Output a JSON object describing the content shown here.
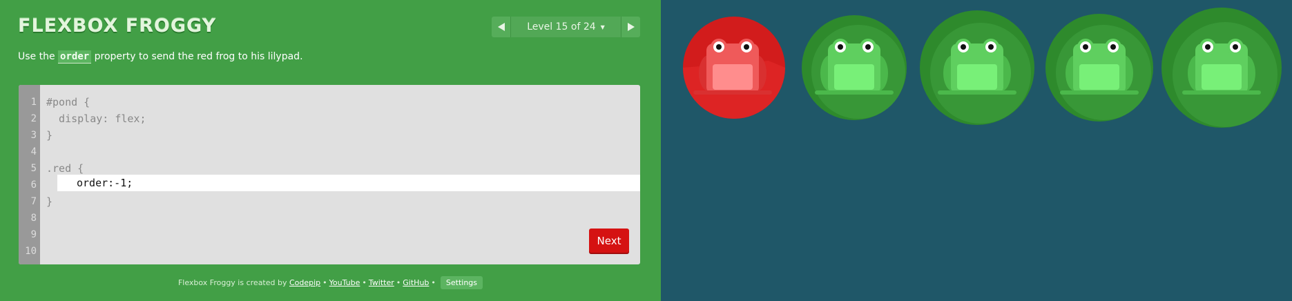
{
  "app": {
    "title": "FLEXBOX FROGGY"
  },
  "level_nav": {
    "indicator": "Level 15 of 24",
    "prev_icon": "triangle-left-icon",
    "next_icon": "triangle-right-icon"
  },
  "instructions": {
    "before": "Use the ",
    "property": "order",
    "after": " property to send the red frog to his lilypad."
  },
  "editor": {
    "line_numbers": [
      "1",
      "2",
      "3",
      "4",
      "5",
      "6",
      "7",
      "8",
      "9",
      "10"
    ],
    "lines": [
      "#pond {",
      "  display: flex;",
      "}",
      "",
      ".red {",
      "",
      "}",
      "",
      "",
      ""
    ],
    "input_value": "order:-1;",
    "next_label": "Next"
  },
  "footer": {
    "prefix": "Flexbox Froggy is created by",
    "links": [
      "Codepip",
      "YouTube",
      "Twitter",
      "GitHub"
    ],
    "settings_label": "Settings"
  },
  "pond": {
    "frogs": [
      "red",
      "green",
      "green",
      "green",
      "green"
    ],
    "lilypads": [
      "red",
      "green",
      "green",
      "green",
      "green"
    ]
  },
  "colors": {
    "sidebar_bg": "#429f46",
    "pond_bg": "#1f5768",
    "editor_bg": "#e0e0e0",
    "next_button": "#d51212",
    "lily_green": "#2e8a2c",
    "lily_green_light": "#3fa03f",
    "lily_red": "#d21c1c",
    "frog_green": "#5fcf5f",
    "frog_red": "#ef5a5a"
  }
}
